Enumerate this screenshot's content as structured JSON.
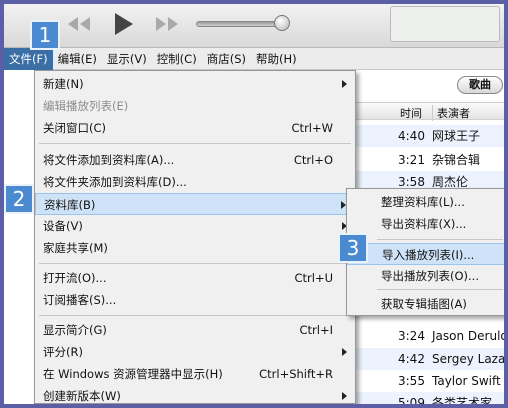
{
  "menubar": {
    "items": [
      {
        "label": "文件(F)"
      },
      {
        "label": "编辑(E)"
      },
      {
        "label": "显示(V)"
      },
      {
        "label": "控制(C)"
      },
      {
        "label": "商店(S)"
      },
      {
        "label": "帮助(H)"
      }
    ]
  },
  "toolbar": {
    "icons": [
      "previous-icon",
      "play-icon",
      "next-icon",
      "volume-slider"
    ]
  },
  "content": {
    "songs_button": "歌曲",
    "columns": {
      "time": "时间",
      "artist": "表演者"
    },
    "tracks": [
      {
        "time": "4:40",
        "artist": "网球王子"
      },
      {
        "time": "3:21",
        "artist": "杂锦合辑"
      },
      {
        "time": "3:58",
        "artist": "周杰伦"
      },
      {
        "time": "3:24",
        "artist": "Jason Derulo"
      },
      {
        "time": "4:42",
        "artist": "Sergey Lazarev"
      },
      {
        "time": "3:55",
        "artist": "Taylor Swift"
      },
      {
        "time": "5:09",
        "artist": "各类艺术家"
      }
    ]
  },
  "file_menu": {
    "items": [
      {
        "label": "新建(N)",
        "shortcut": ""
      },
      {
        "label": "编辑播放列表(E)",
        "shortcut": ""
      },
      {
        "label": "关闭窗口(C)",
        "shortcut": "Ctrl+W"
      },
      {
        "label": "将文件添加到资料库(A)...",
        "shortcut": "Ctrl+O"
      },
      {
        "label": "将文件夹添加到资料库(D)...",
        "shortcut": ""
      },
      {
        "label": "资料库(B)",
        "shortcut": ""
      },
      {
        "label": "设备(V)",
        "shortcut": ""
      },
      {
        "label": "家庭共享(M)",
        "shortcut": ""
      },
      {
        "label": "打开流(O)...",
        "shortcut": "Ctrl+U"
      },
      {
        "label": "订阅播客(S)...",
        "shortcut": ""
      },
      {
        "label": "显示简介(G)",
        "shortcut": "Ctrl+I"
      },
      {
        "label": "评分(R)",
        "shortcut": ""
      },
      {
        "label": "在 Windows 资源管理器中显示(H)",
        "shortcut": "Ctrl+Shift+R"
      },
      {
        "label": "创建新版本(W)",
        "shortcut": ""
      }
    ]
  },
  "library_submenu": {
    "items": [
      {
        "label": "整理资料库(L)..."
      },
      {
        "label": "导出资料库(X)..."
      },
      {
        "label": "导入播放列表(I)..."
      },
      {
        "label": "导出播放列表(O)..."
      },
      {
        "label": "获取专辑插图(A)"
      }
    ]
  },
  "badges": [
    "1",
    "2",
    "3"
  ],
  "colors": {
    "badge": "#4a8ad0",
    "menu_highlight": "#cfe3f8",
    "menubar_active": "#3a6ea5",
    "frame": "#5a5fa6"
  }
}
